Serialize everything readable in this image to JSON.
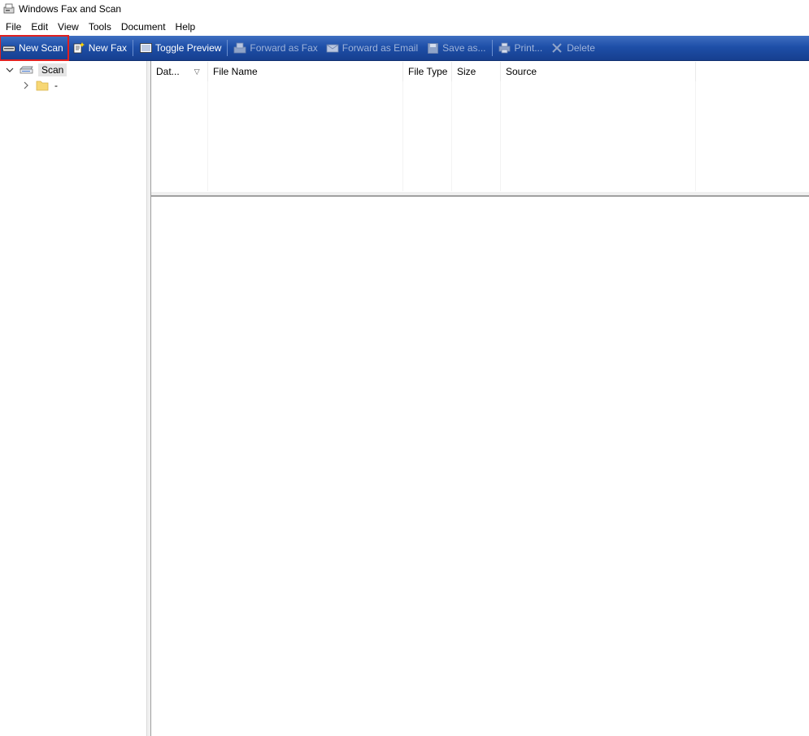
{
  "window": {
    "title": "Windows Fax and Scan",
    "icon": "fax-scanner-icon"
  },
  "menu": [
    "File",
    "Edit",
    "View",
    "Tools",
    "Document",
    "Help"
  ],
  "toolbar": {
    "new_scan": "New Scan",
    "new_fax": "New Fax",
    "toggle_preview": "Toggle Preview",
    "forward_fax": "Forward as Fax",
    "forward_email": "Forward as Email",
    "save_as": "Save as...",
    "print": "Print...",
    "delete": "Delete"
  },
  "tree": {
    "root_label": "Scan",
    "child_label": "-"
  },
  "columns": [
    "Dat...",
    "File Name",
    "File Type",
    "Size",
    "Source"
  ],
  "sort_indicator": "▽",
  "colors": {
    "toolbar": "#1e4fa8",
    "highlight": "#e02020"
  }
}
